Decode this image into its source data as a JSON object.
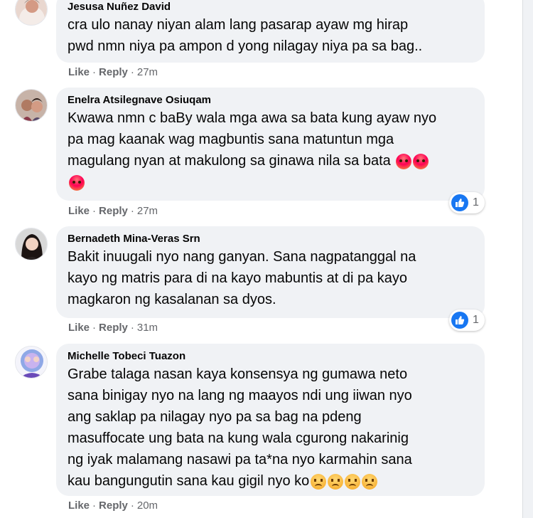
{
  "comments": [
    {
      "author": "Jesusa Nuñez David",
      "lines": [
        "cra ulo nanay niyan alam lang pasarap ayaw mg hirap",
        "pwd nmn niya pa ampon d yong nilagay niya pa sa bag.."
      ],
      "like": "Like",
      "reply": "Reply",
      "time": "27m"
    },
    {
      "author": "Enelra Atsilegnave Osiuqam",
      "lines": [
        "Kwawa nmn c baBy wala mga awa sa bata kung ayaw nyo",
        "pa mag kaanak wag magbuntis sana matuntun mga",
        "magulang nyan at makulong sa ginawa nila sa bata"
      ],
      "like": "Like",
      "reply": "Reply",
      "time": "27m",
      "reaction_count": "1",
      "emoji": "angry-face-emoji"
    },
    {
      "author": "Bernadeth Mina-Veras Srn",
      "lines": [
        "Bakit inuugali nyo nang ganyan. Sana nagpatanggal na",
        "kayo ng matris para di na kayo mabuntis at di pa kayo",
        "magkaron ng kasalanan sa dyos."
      ],
      "like": "Like",
      "reply": "Reply",
      "time": "31m",
      "reaction_count": "1"
    },
    {
      "author": "Michelle Tobeci Tuazon",
      "lines": [
        "Grabe talaga nasan kaya konsensya ng gumawa neto",
        "sana binigay nyo na lang ng maayos ndi ung iiwan nyo",
        "ang saklap pa nilagay nyo pa sa bag na pdeng",
        "masuffocate ung bata na kung wala cgurong nakarinig",
        "ng iyak malamang nasawi pa ta*na nyo karmahin sana",
        "kau bangungutin sana kau gigil nyo ko"
      ],
      "like": "Like",
      "reply": "Reply",
      "time": "20m",
      "emoji": "frowning-face-emoji"
    }
  ],
  "separator": "·",
  "colors": {
    "bubble": "#f0f2f5",
    "meta": "#65676b",
    "like_blue": "#1877f2"
  }
}
